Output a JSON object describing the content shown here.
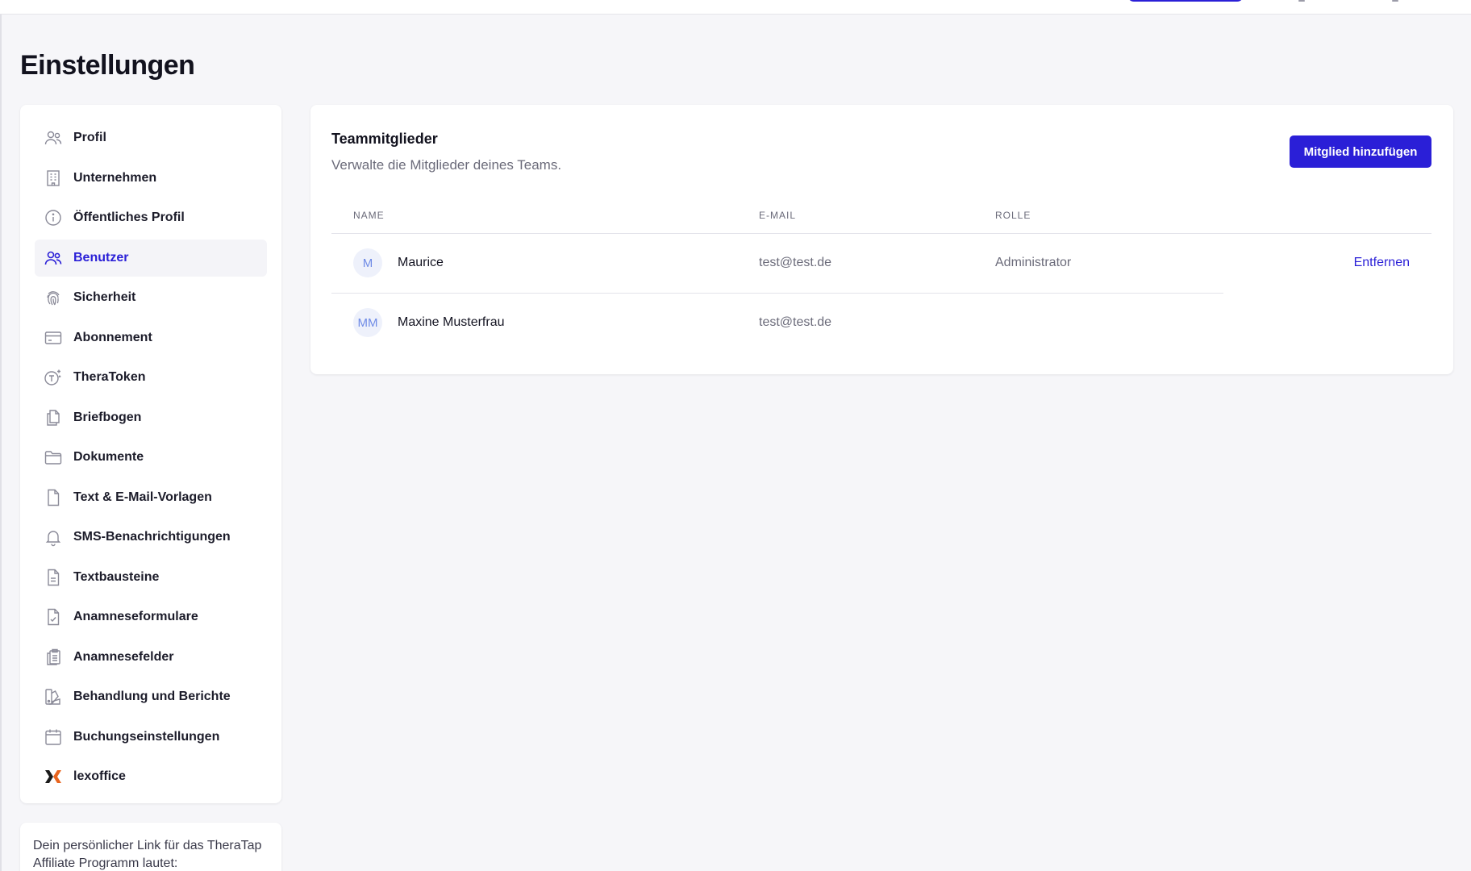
{
  "page": {
    "title": "Einstellungen"
  },
  "colors": {
    "accent": "#2a1fd7",
    "background": "#f6f6f9",
    "avatar_bg": "#eef1fb",
    "avatar_text": "#6f8be6",
    "lexoffice_orange": "#e8641e"
  },
  "sidebar": {
    "items": [
      {
        "label": "Profil",
        "icon": "users-icon",
        "active": false
      },
      {
        "label": "Unternehmen",
        "icon": "building-icon",
        "active": false
      },
      {
        "label": "Öffentliches Profil",
        "icon": "info-circle-icon",
        "active": false
      },
      {
        "label": "Benutzer",
        "icon": "users-icon",
        "active": true
      },
      {
        "label": "Sicherheit",
        "icon": "fingerprint-icon",
        "active": false
      },
      {
        "label": "Abonnement",
        "icon": "credit-card-icon",
        "active": false
      },
      {
        "label": "TheraToken",
        "icon": "token-sparkle-icon",
        "active": false
      },
      {
        "label": "Briefbogen",
        "icon": "documents-icon",
        "active": false
      },
      {
        "label": "Dokumente",
        "icon": "folder-icon",
        "active": false
      },
      {
        "label": "Text & E-Mail-Vorlagen",
        "icon": "file-icon",
        "active": false
      },
      {
        "label": "SMS-Benachrichtigungen",
        "icon": "bell-icon",
        "active": false
      },
      {
        "label": "Textbausteine",
        "icon": "file-text-icon",
        "active": false
      },
      {
        "label": "Anamneseformulare",
        "icon": "file-check-icon",
        "active": false
      },
      {
        "label": "Anamnesefelder",
        "icon": "clipboard-icon",
        "active": false
      },
      {
        "label": "Behandlung und Berichte",
        "icon": "swatch-icon",
        "active": false
      },
      {
        "label": "Buchungseinstellungen",
        "icon": "calendar-icon",
        "active": false
      },
      {
        "label": "lexoffice",
        "icon": "lexoffice-logo-icon",
        "active": false
      }
    ]
  },
  "affiliate": {
    "text": "Dein persönlicher Link für das TheraTap Affiliate Programm lautet:"
  },
  "team": {
    "title": "Teammitglieder",
    "subtitle": "Verwalte die Mitglieder deines Teams.",
    "add_button_label": "Mitglied hinzufügen",
    "columns": [
      "NAME",
      "E-MAIL",
      "ROLLE"
    ],
    "members": [
      {
        "initials": "M",
        "name": "Maurice",
        "email": "test@test.de",
        "role": "Administrator",
        "action": "Entfernen"
      },
      {
        "initials": "MM",
        "name": "Maxine Musterfrau",
        "email": "test@test.de",
        "role": "",
        "action": ""
      }
    ]
  }
}
